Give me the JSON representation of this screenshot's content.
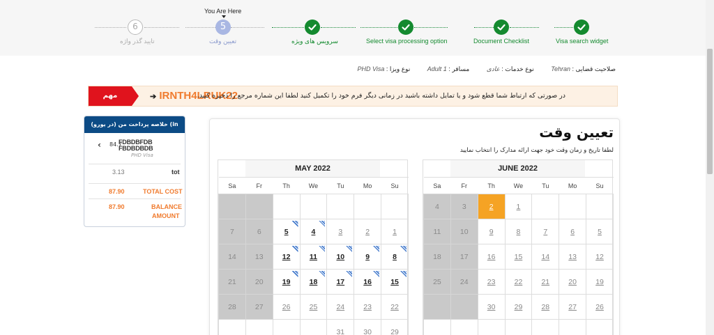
{
  "stepper": {
    "you_are_here": "You Are Here",
    "steps": [
      {
        "number": "",
        "label": "Visa search widget",
        "state": "done"
      },
      {
        "number": "",
        "label": "Document Checklist",
        "state": "done"
      },
      {
        "number": "",
        "label": "Select visa processing option",
        "state": "done"
      },
      {
        "number": "",
        "label": "سرویس های ویژه",
        "state": "done"
      },
      {
        "number": "5",
        "label": "تعیین وقت",
        "state": "current"
      },
      {
        "number": "6",
        "label": "تایید گذر واژه",
        "state": "todo"
      }
    ]
  },
  "info": {
    "jurisdiction_label": "صلاحیت قضایی :",
    "jurisdiction_value": "Tehran",
    "service_label": "نوع خدمات :",
    "service_value": "عادی",
    "traveller_label": "مسافر :",
    "traveller_value": "Adult 1",
    "visa_label": "نوع ویزا :",
    "visa_value": "PHD Visa"
  },
  "notice": {
    "badge": "مهم",
    "message": "در صورتی که ارتباط شما قطع شود و یا تمایل داشته باشید در زمانی دیگر فرم خود را تکمیل کنید لطفا این شماره مرجع را ذخیره کنید.",
    "arrow": "➔",
    "reference": "IRNTH4LRUK22"
  },
  "summary": {
    "title": "خلاصه پرداخت من (در یورو)  (in EUR)",
    "item_code": "84.7",
    "item_name_line1": "FDBDBFDB",
    "item_name_line2": "FBDBDBDB",
    "item_sub": "PHD Visa",
    "tot_label": "tot",
    "tot_value": "3.13",
    "total_cost_label": "TOTAL COST",
    "total_cost_value": "87.90",
    "balance_label_1": "BALANCE",
    "balance_label_2": "AMOUNT",
    "balance_value": "87.90",
    "accent_color": "#f07b2e",
    "header_color": "#0c4b85"
  },
  "main": {
    "title": "تعیین وقت",
    "subtitle": "لطفا تاریخ و زمان وقت خود جهت ارائه مدارک را انتخاب نمایید"
  },
  "calendars": {
    "weekdays": [
      "Sa",
      "Fr",
      "Th",
      "We",
      "Tu",
      "Mo",
      "Su"
    ],
    "may": {
      "title": "MAY 2022",
      "weeks": [
        [
          {
            "d": "",
            "s": "past"
          },
          {
            "d": "",
            "s": "past"
          },
          {
            "d": "",
            "s": "empty"
          },
          {
            "d": "",
            "s": "empty"
          },
          {
            "d": "",
            "s": "empty"
          },
          {
            "d": "",
            "s": "empty"
          },
          {
            "d": "",
            "s": "empty"
          }
        ],
        [
          {
            "d": "7",
            "s": "past"
          },
          {
            "d": "6",
            "s": "past"
          },
          {
            "d": "5",
            "s": "strong",
            "tag": true
          },
          {
            "d": "4",
            "s": "strong",
            "tag": true
          },
          {
            "d": "3",
            "s": "avail"
          },
          {
            "d": "2",
            "s": "avail"
          },
          {
            "d": "1",
            "s": "avail"
          }
        ],
        [
          {
            "d": "14",
            "s": "past"
          },
          {
            "d": "13",
            "s": "past"
          },
          {
            "d": "12",
            "s": "strong",
            "tag": true
          },
          {
            "d": "11",
            "s": "strong",
            "tag": true
          },
          {
            "d": "10",
            "s": "strong",
            "tag": true
          },
          {
            "d": "9",
            "s": "strong",
            "tag": true
          },
          {
            "d": "8",
            "s": "strong",
            "tag": true
          }
        ],
        [
          {
            "d": "21",
            "s": "past"
          },
          {
            "d": "20",
            "s": "past"
          },
          {
            "d": "19",
            "s": "strong",
            "tag": true
          },
          {
            "d": "18",
            "s": "strong",
            "tag": true
          },
          {
            "d": "17",
            "s": "strong",
            "tag": true
          },
          {
            "d": "16",
            "s": "strong",
            "tag": true
          },
          {
            "d": "15",
            "s": "strong",
            "tag": true
          }
        ],
        [
          {
            "d": "28",
            "s": "past"
          },
          {
            "d": "27",
            "s": "past"
          },
          {
            "d": "26",
            "s": "avail"
          },
          {
            "d": "25",
            "s": "avail"
          },
          {
            "d": "24",
            "s": "avail"
          },
          {
            "d": "23",
            "s": "avail"
          },
          {
            "d": "22",
            "s": "avail"
          }
        ],
        [
          {
            "d": "",
            "s": "empty"
          },
          {
            "d": "",
            "s": "empty"
          },
          {
            "d": "",
            "s": "empty"
          },
          {
            "d": "",
            "s": "empty"
          },
          {
            "d": "31",
            "s": "avail"
          },
          {
            "d": "30",
            "s": "avail"
          },
          {
            "d": "29",
            "s": "avail"
          }
        ]
      ]
    },
    "june": {
      "title": "JUNE 2022",
      "weeks": [
        [
          {
            "d": "4",
            "s": "past"
          },
          {
            "d": "3",
            "s": "past"
          },
          {
            "d": "2",
            "s": "today"
          },
          {
            "d": "1",
            "s": "avail"
          },
          {
            "d": "",
            "s": "empty"
          },
          {
            "d": "",
            "s": "empty"
          },
          {
            "d": "",
            "s": "empty"
          }
        ],
        [
          {
            "d": "11",
            "s": "past"
          },
          {
            "d": "10",
            "s": "past"
          },
          {
            "d": "9",
            "s": "avail"
          },
          {
            "d": "8",
            "s": "avail"
          },
          {
            "d": "7",
            "s": "avail"
          },
          {
            "d": "6",
            "s": "avail"
          },
          {
            "d": "5",
            "s": "avail"
          }
        ],
        [
          {
            "d": "18",
            "s": "past"
          },
          {
            "d": "17",
            "s": "past"
          },
          {
            "d": "16",
            "s": "avail"
          },
          {
            "d": "15",
            "s": "avail"
          },
          {
            "d": "14",
            "s": "avail"
          },
          {
            "d": "13",
            "s": "avail"
          },
          {
            "d": "12",
            "s": "avail"
          }
        ],
        [
          {
            "d": "25",
            "s": "past"
          },
          {
            "d": "24",
            "s": "past"
          },
          {
            "d": "23",
            "s": "avail"
          },
          {
            "d": "22",
            "s": "avail"
          },
          {
            "d": "21",
            "s": "avail"
          },
          {
            "d": "20",
            "s": "avail"
          },
          {
            "d": "19",
            "s": "avail"
          }
        ],
        [
          {
            "d": "",
            "s": "past"
          },
          {
            "d": "",
            "s": "past"
          },
          {
            "d": "30",
            "s": "avail"
          },
          {
            "d": "29",
            "s": "avail"
          },
          {
            "d": "28",
            "s": "avail"
          },
          {
            "d": "27",
            "s": "avail"
          },
          {
            "d": "26",
            "s": "avail"
          }
        ],
        [
          {
            "d": "",
            "s": "empty"
          },
          {
            "d": "",
            "s": "empty"
          },
          {
            "d": "",
            "s": "empty"
          },
          {
            "d": "",
            "s": "empty"
          },
          {
            "d": "",
            "s": "empty"
          },
          {
            "d": "",
            "s": "empty"
          },
          {
            "d": "",
            "s": "empty"
          }
        ]
      ]
    },
    "today_color": "#f5a324",
    "past_color": "#c9c9c9"
  }
}
